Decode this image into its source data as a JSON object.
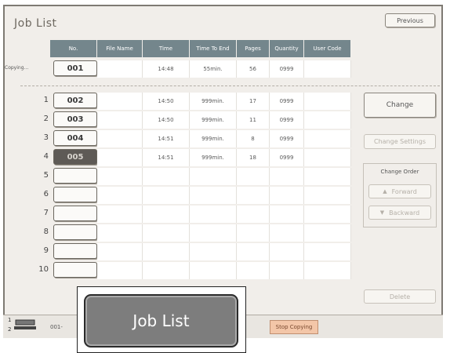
{
  "title": "Job List",
  "buttons": {
    "previous": "Previous",
    "change": "Change",
    "change_settings": "Change Settings",
    "change_order": "Change Order",
    "forward": "Forward",
    "backward": "Backward",
    "delete": "Delete",
    "stop_copying": "Stop Copying"
  },
  "columns": [
    "No.",
    "File Name",
    "Time",
    "Time To End",
    "Pages",
    "Quantity",
    "User Code"
  ],
  "current_job": {
    "status": "Copying...",
    "number": "001",
    "time": "14:48",
    "time_to_end": "55min.",
    "pages": "56",
    "quantity": "0999"
  },
  "jobs": [
    {
      "index": "1",
      "number": "002",
      "time": "14:50",
      "time_to_end": "999min.",
      "pages": "17",
      "quantity": "0999",
      "selected": false
    },
    {
      "index": "2",
      "number": "003",
      "time": "14:50",
      "time_to_end": "999min.",
      "pages": "11",
      "quantity": "0999",
      "selected": false
    },
    {
      "index": "3",
      "number": "004",
      "time": "14:51",
      "time_to_end": "999min.",
      "pages": "8",
      "quantity": "0999",
      "selected": false
    },
    {
      "index": "4",
      "number": "005",
      "time": "14:51",
      "time_to_end": "999min.",
      "pages": "18",
      "quantity": "0999",
      "selected": true
    },
    {
      "index": "5",
      "number": "",
      "time": "",
      "time_to_end": "",
      "pages": "",
      "quantity": "",
      "selected": false
    },
    {
      "index": "6",
      "number": "",
      "time": "",
      "time_to_end": "",
      "pages": "",
      "quantity": "",
      "selected": false
    },
    {
      "index": "7",
      "number": "",
      "time": "",
      "time_to_end": "",
      "pages": "",
      "quantity": "",
      "selected": false
    },
    {
      "index": "8",
      "number": "",
      "time": "",
      "time_to_end": "",
      "pages": "",
      "quantity": "",
      "selected": false
    },
    {
      "index": "9",
      "number": "",
      "time": "",
      "time_to_end": "",
      "pages": "",
      "quantity": "",
      "selected": false
    },
    {
      "index": "10",
      "number": "",
      "time": "",
      "time_to_end": "",
      "pages": "",
      "quantity": "",
      "selected": false
    }
  ],
  "status_bar": {
    "counter_1": "1",
    "counter_2": "2",
    "job_ref": "001-"
  },
  "popup": {
    "label": "Job List"
  },
  "colors": {
    "header": "#74868c",
    "panel": "#f1eeea",
    "stop_button": "#f3c6a8"
  }
}
